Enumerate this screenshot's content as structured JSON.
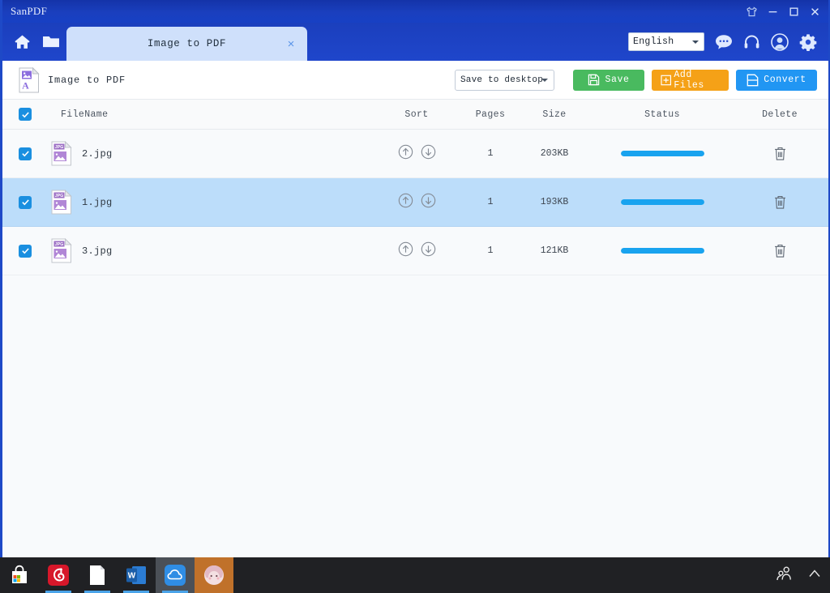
{
  "window": {
    "app_title": "SanPDF",
    "controls": [
      {
        "name": "skin-icon",
        "label": "Skin"
      },
      {
        "name": "minimize-button",
        "label": "Minimize"
      },
      {
        "name": "maximize-button",
        "label": "Maximize"
      },
      {
        "name": "close-button",
        "label": "Close"
      }
    ]
  },
  "tabbar": {
    "home_icon": "home-icon",
    "open_icon": "folder-open-icon",
    "tab_label": "Image to PDF",
    "tab_close": "×",
    "language": "English",
    "tools": [
      "feedback-icon",
      "headset-icon",
      "account-icon",
      "settings-icon"
    ]
  },
  "actionbar": {
    "mode_title": "Image to PDF",
    "destination": "Save to desktop",
    "save_label": "Save",
    "add_files_label": "Add Files",
    "convert_label": "Convert"
  },
  "table": {
    "columns": {
      "filename": "FileName",
      "sort": "Sort",
      "pages": "Pages",
      "size": "Size",
      "status": "Status",
      "delete": "Delete"
    },
    "select_all_checked": true,
    "rows": [
      {
        "checked": true,
        "filetype": "JPG",
        "name": "2.jpg",
        "pages": "1",
        "size": "203KB",
        "progress": 100,
        "selected": false
      },
      {
        "checked": true,
        "filetype": "JPG",
        "name": "1.jpg",
        "pages": "1",
        "size": "193KB",
        "progress": 100,
        "selected": true
      },
      {
        "checked": true,
        "filetype": "JPG",
        "name": "3.jpg",
        "pages": "1",
        "size": "121KB",
        "progress": 100,
        "selected": false
      }
    ]
  },
  "taskbar": {
    "items": [
      {
        "name": "taskbar-store",
        "label": "Microsoft Store"
      },
      {
        "name": "taskbar-music",
        "label": "NetEase Cloud Music"
      },
      {
        "name": "taskbar-document",
        "label": "Document"
      },
      {
        "name": "taskbar-word",
        "label": "Word"
      },
      {
        "name": "taskbar-cloud",
        "label": "Cloud App"
      },
      {
        "name": "taskbar-avatar",
        "label": "Avatar App"
      }
    ],
    "tray": [
      "people-icon",
      "show-hidden-icons-chevron"
    ]
  },
  "colors": {
    "titlebar": "#1a3fbe",
    "tab_active": "#cfe0fb",
    "row_selected": "#bcddfa",
    "save_green": "#49ba5f",
    "add_orange": "#f5a117",
    "convert_blue": "#2196f3",
    "progress_blue": "#19a3ef",
    "checkbox_blue": "#1a8fe0"
  }
}
